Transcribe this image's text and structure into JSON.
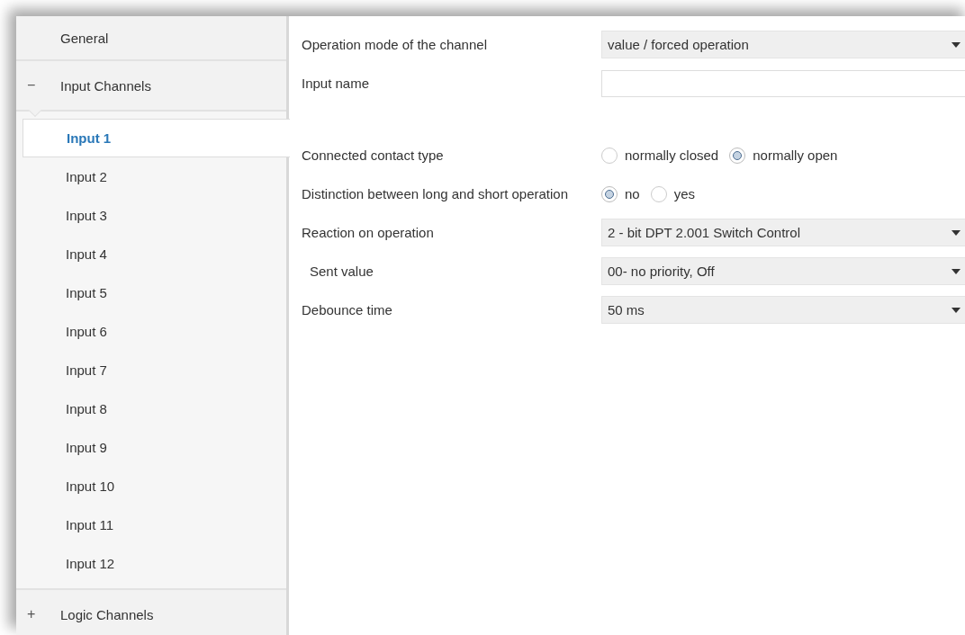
{
  "sidebar": {
    "items": [
      {
        "kind": "page",
        "label": "General"
      },
      {
        "kind": "group",
        "label": "Input Channels",
        "expander": "−",
        "children": [
          {
            "label": "Input 1",
            "selected": true
          },
          {
            "label": "Input 2",
            "selected": false
          },
          {
            "label": "Input 3",
            "selected": false
          },
          {
            "label": "Input 4",
            "selected": false
          },
          {
            "label": "Input 5",
            "selected": false
          },
          {
            "label": "Input 6",
            "selected": false
          },
          {
            "label": "Input 7",
            "selected": false
          },
          {
            "label": "Input 8",
            "selected": false
          },
          {
            "label": "Input 9",
            "selected": false
          },
          {
            "label": "Input 10",
            "selected": false
          },
          {
            "label": "Input 11",
            "selected": false
          },
          {
            "label": "Input 12",
            "selected": false
          }
        ]
      },
      {
        "kind": "group",
        "label": "Logic Channels",
        "expander": "+"
      }
    ]
  },
  "parameters": [
    {
      "kind": "dropdown",
      "label": "Operation mode of the channel",
      "value": "value / forced operation"
    },
    {
      "kind": "text",
      "label": "Input name"
    },
    {
      "kind": "radio",
      "label": "Connected contact type",
      "separated": true,
      "options": [
        {
          "label": "normally closed",
          "selected": false
        },
        {
          "label": "normally open",
          "selected": true
        }
      ]
    },
    {
      "kind": "radio",
      "label": "Distinction between long and short operation",
      "options": [
        {
          "label": "no",
          "selected": true
        },
        {
          "label": "yes",
          "selected": false
        }
      ]
    },
    {
      "kind": "dropdown",
      "label": "Reaction on operation",
      "value": "2 - bit DPT 2.001 Switch Control"
    },
    {
      "kind": "dropdown",
      "label": "Sent value",
      "indented": true,
      "value": "00- no priority, Off"
    },
    {
      "kind": "dropdown",
      "label": "Debounce time",
      "value": "50 ms"
    }
  ]
}
